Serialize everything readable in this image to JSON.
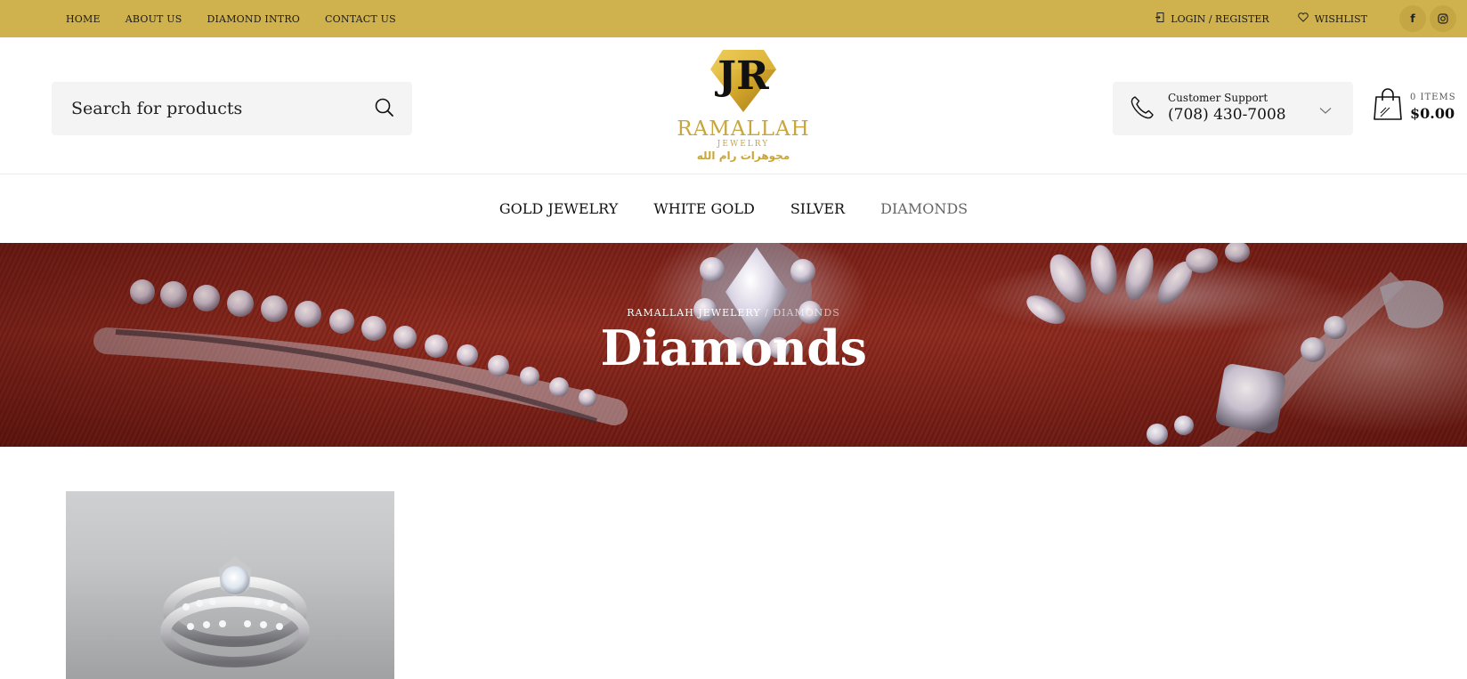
{
  "topbar": {
    "nav": [
      "HOME",
      "ABOUT US",
      "DIAMOND INTRO",
      "CONTACT US"
    ],
    "login": "LOGIN / REGISTER",
    "wishlist": "WISHLIST",
    "social": [
      {
        "icon": "facebook-icon",
        "glyph": "f"
      },
      {
        "icon": "instagram-icon",
        "glyph": "◎"
      }
    ],
    "background": "#cfb24e"
  },
  "header": {
    "search_placeholder": "Search for products",
    "logo": {
      "monogram": "JR",
      "brand": "RAMALLAH",
      "sub": "JEWELRY",
      "arabic": "مجوهرات رام الله"
    },
    "support": {
      "label": "Customer Support",
      "phone": "(708) 430-7008"
    },
    "cart": {
      "items": "0 ITEMS",
      "total": "$0.00"
    },
    "accent": "#c9a63c"
  },
  "main_nav": [
    "GOLD JEWELRY",
    "WHITE GOLD",
    "SILVER",
    "DIAMONDS"
  ],
  "main_nav_active": "DIAMONDS",
  "hero": {
    "breadcrumb_home": "RAMALLAH JEWELERY",
    "breadcrumb_sep": " / ",
    "breadcrumb_current": "DIAMONDS",
    "title": "Diamonds"
  }
}
